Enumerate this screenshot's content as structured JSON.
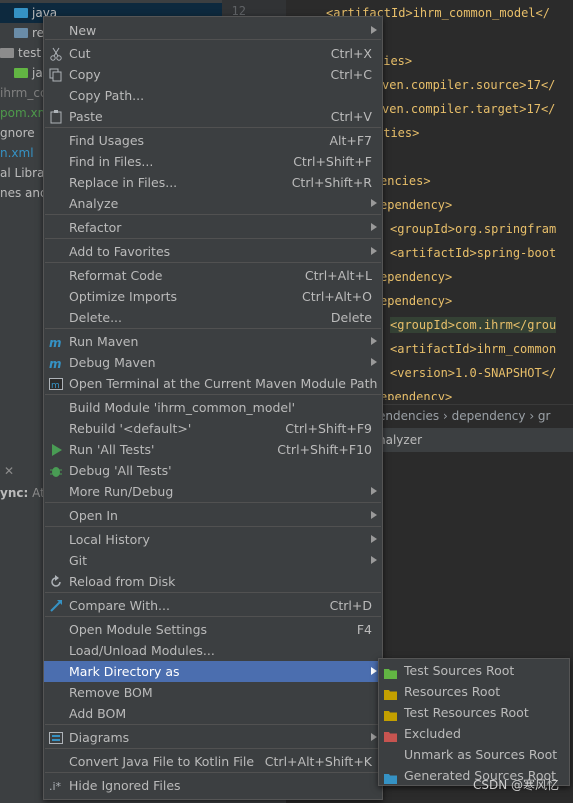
{
  "project_tree": {
    "items": [
      {
        "label": "java",
        "color": "#3592c4"
      },
      {
        "label": "re",
        "color": "#3592c4"
      },
      {
        "label": "test",
        "color": "#8c8c8c"
      },
      {
        "label": "ja",
        "color": "#62b543"
      },
      {
        "label": "ihrm_co",
        "color": "#808080"
      },
      {
        "label": "pom.xm",
        "color": "#4e9a4b"
      },
      {
        "label": "gnore",
        "color": "#bbbbbb"
      },
      {
        "label": "n.xml",
        "color": "#3592c4"
      },
      {
        "label": "al Librar",
        "color": "#bbbbbb"
      },
      {
        "label": "nes and",
        "color": "#bbbbbb"
      }
    ]
  },
  "editor": {
    "line_numbers": [
      "12"
    ],
    "lines": [
      {
        "text": "<artifactId>ihrm_common_model</",
        "kind": "tag"
      },
      {
        "text": "",
        "kind": "tag"
      },
      {
        "text": "ties>",
        "kind": "tag"
      },
      {
        "text": "ven.compiler.source>17</",
        "kind": "tag"
      },
      {
        "text": "ven.compiler.target>17</",
        "kind": "tag"
      },
      {
        "text": "rties>",
        "kind": "tag"
      },
      {
        "text": "",
        "kind": "tag"
      },
      {
        "text": "encies>",
        "kind": "tag"
      },
      {
        "text": "ependency>",
        "kind": "tag"
      },
      {
        "text": "<groupId>org.springfram",
        "kind": "tag"
      },
      {
        "text": "<artifactId>spring-boot",
        "kind": "tag"
      },
      {
        "text": "ependency>",
        "kind": "tag"
      },
      {
        "text": "ependency>",
        "kind": "tag"
      },
      {
        "text": "<groupId>com.ihrm</grou",
        "kind": "tag"
      },
      {
        "text": "<artifactId>ihrm_common",
        "kind": "tag"
      },
      {
        "text": "<version>1.0-SNAPSHOT</",
        "kind": "tag"
      },
      {
        "text": "ependency>",
        "kind": "tag"
      }
    ],
    "breadcrumb": "endencies  ›  dependency  ›  gr",
    "analyzer_label": "nalyzer"
  },
  "run_panel": {
    "sync_label": "ync:",
    "sync_suffix": "At"
  },
  "context_menu": {
    "items": [
      {
        "label": "New",
        "shortcut": "",
        "submenu": true
      },
      {
        "label": "Cut",
        "shortcut": "Ctrl+X",
        "icon": "cut-icon"
      },
      {
        "label": "Copy",
        "shortcut": "Ctrl+C",
        "icon": "copy-icon"
      },
      {
        "label": "Copy Path...",
        "shortcut": ""
      },
      {
        "label": "Paste",
        "shortcut": "Ctrl+V",
        "icon": "paste-icon"
      },
      {
        "label": "Find Usages",
        "shortcut": "Alt+F7"
      },
      {
        "label": "Find in Files...",
        "shortcut": "Ctrl+Shift+F"
      },
      {
        "label": "Replace in Files...",
        "shortcut": "Ctrl+Shift+R"
      },
      {
        "label": "Analyze",
        "shortcut": "",
        "submenu": true
      },
      {
        "label": "Refactor",
        "shortcut": "",
        "submenu": true
      },
      {
        "label": "Add to Favorites",
        "shortcut": "",
        "submenu": true
      },
      {
        "label": "Reformat Code",
        "shortcut": "Ctrl+Alt+L"
      },
      {
        "label": "Optimize Imports",
        "shortcut": "Ctrl+Alt+O"
      },
      {
        "label": "Delete...",
        "shortcut": "Delete"
      },
      {
        "label": "Run Maven",
        "shortcut": "",
        "submenu": true,
        "icon": "maven-icon"
      },
      {
        "label": "Debug Maven",
        "shortcut": "",
        "submenu": true,
        "icon": "maven-icon"
      },
      {
        "label": "Open Terminal at the Current Maven Module Path",
        "shortcut": "",
        "icon": "terminal-icon"
      },
      {
        "label": "Build Module 'ihrm_common_model'",
        "shortcut": ""
      },
      {
        "label": "Rebuild '<default>'",
        "shortcut": "Ctrl+Shift+F9"
      },
      {
        "label": "Run 'All Tests'",
        "shortcut": "Ctrl+Shift+F10",
        "icon": "run-icon"
      },
      {
        "label": "Debug 'All Tests'",
        "shortcut": "",
        "icon": "debug-icon"
      },
      {
        "label": "More Run/Debug",
        "shortcut": "",
        "submenu": true
      },
      {
        "label": "Open In",
        "shortcut": "",
        "submenu": true
      },
      {
        "label": "Local History",
        "shortcut": "",
        "submenu": true
      },
      {
        "label": "Git",
        "shortcut": "",
        "submenu": true
      },
      {
        "label": "Reload from Disk",
        "shortcut": "",
        "icon": "reload-icon"
      },
      {
        "label": "Compare With...",
        "shortcut": "Ctrl+D",
        "icon": "compare-icon"
      },
      {
        "label": "Open Module Settings",
        "shortcut": "F4"
      },
      {
        "label": "Load/Unload Modules...",
        "shortcut": ""
      },
      {
        "label": "Mark Directory as",
        "shortcut": "",
        "submenu": true,
        "selected": true
      },
      {
        "label": "Remove BOM",
        "shortcut": ""
      },
      {
        "label": "Add BOM",
        "shortcut": ""
      },
      {
        "label": "Diagrams",
        "shortcut": "",
        "submenu": true,
        "icon": "diagram-icon"
      },
      {
        "label": "Convert Java File to Kotlin File",
        "shortcut": "Ctrl+Alt+Shift+K"
      },
      {
        "label": "Hide Ignored Files",
        "shortcut": "",
        "icon": "ignore-icon"
      }
    ]
  },
  "submenu": {
    "items": [
      {
        "label": "Test Sources Root",
        "icon": "test-sources-root-icon",
        "color": "#62b543"
      },
      {
        "label": "Resources Root",
        "icon": "resources-root-icon",
        "color": "#c4a000"
      },
      {
        "label": "Test Resources Root",
        "icon": "test-resources-root-icon",
        "color": "#c4a000"
      },
      {
        "label": "Excluded",
        "icon": "excluded-folder-icon",
        "color": "#c75450"
      },
      {
        "label": "Unmark as Sources Root",
        "icon": "",
        "color": ""
      },
      {
        "label": "Generated Sources Root",
        "icon": "generated-sources-root-icon",
        "color": "#3592c4"
      }
    ]
  },
  "watermark": "CSDN @寒风忆",
  "colors": {
    "menu_bg": "#3c3f41",
    "selection": "#4b6eaf",
    "editor_bg": "#2b2b2b",
    "xml_tag": "#e8bf6a"
  }
}
